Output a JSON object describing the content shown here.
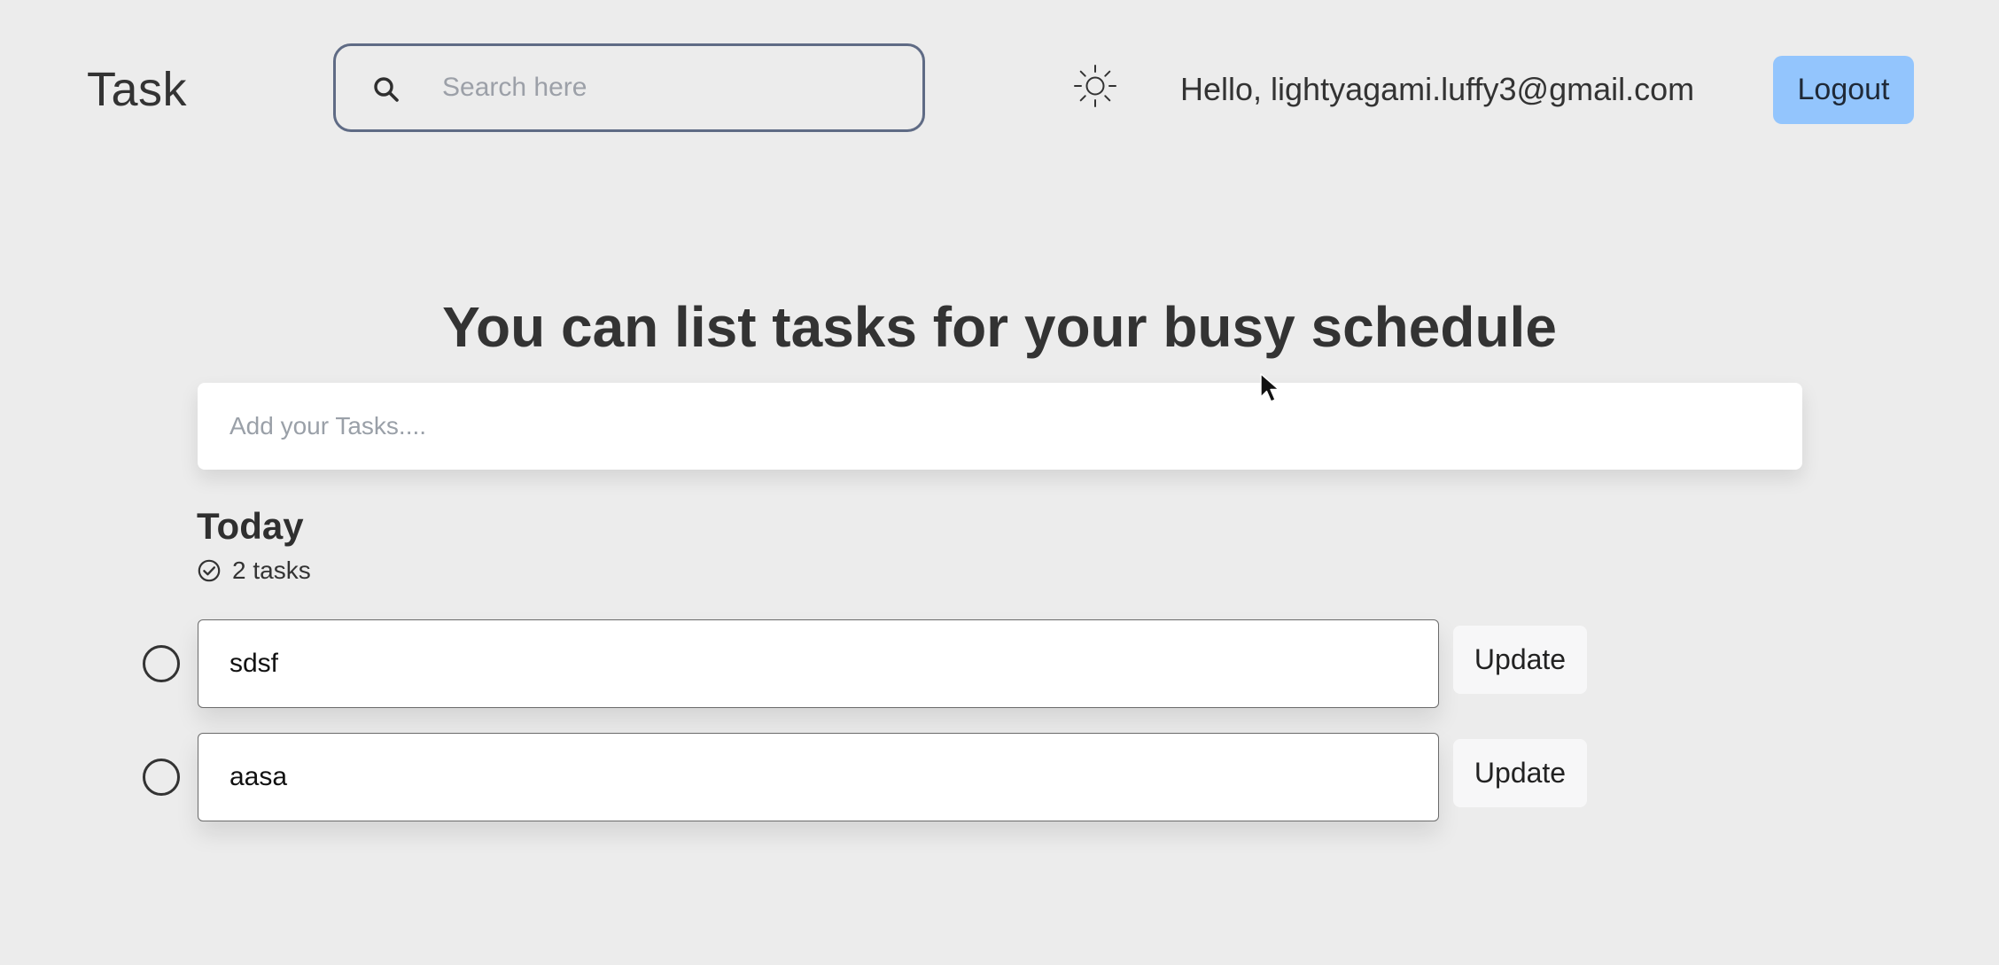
{
  "header": {
    "brand": "Task",
    "search": {
      "placeholder": "Search here",
      "value": "",
      "icon": "search-icon"
    },
    "theme_toggle_icon": "sun-icon",
    "greeting": "Hello, lightyagami.luffy3@gmail.com",
    "logout_label": "Logout"
  },
  "main": {
    "headline": "You can list tasks for your busy schedule",
    "add_task": {
      "placeholder": "Add your Tasks....",
      "value": ""
    },
    "section": {
      "title": "Today",
      "count_label": "2 tasks",
      "count_icon": "check-circle-icon"
    },
    "tasks": [
      {
        "value": "sdsf",
        "update_label": "Update",
        "completed": false
      },
      {
        "value": "aasa",
        "update_label": "Update",
        "completed": false
      }
    ]
  },
  "colors": {
    "background": "#ececec",
    "accent": "#93c5fd",
    "text": "#333333",
    "search_border": "#5f6b85",
    "card": "#ffffff"
  }
}
